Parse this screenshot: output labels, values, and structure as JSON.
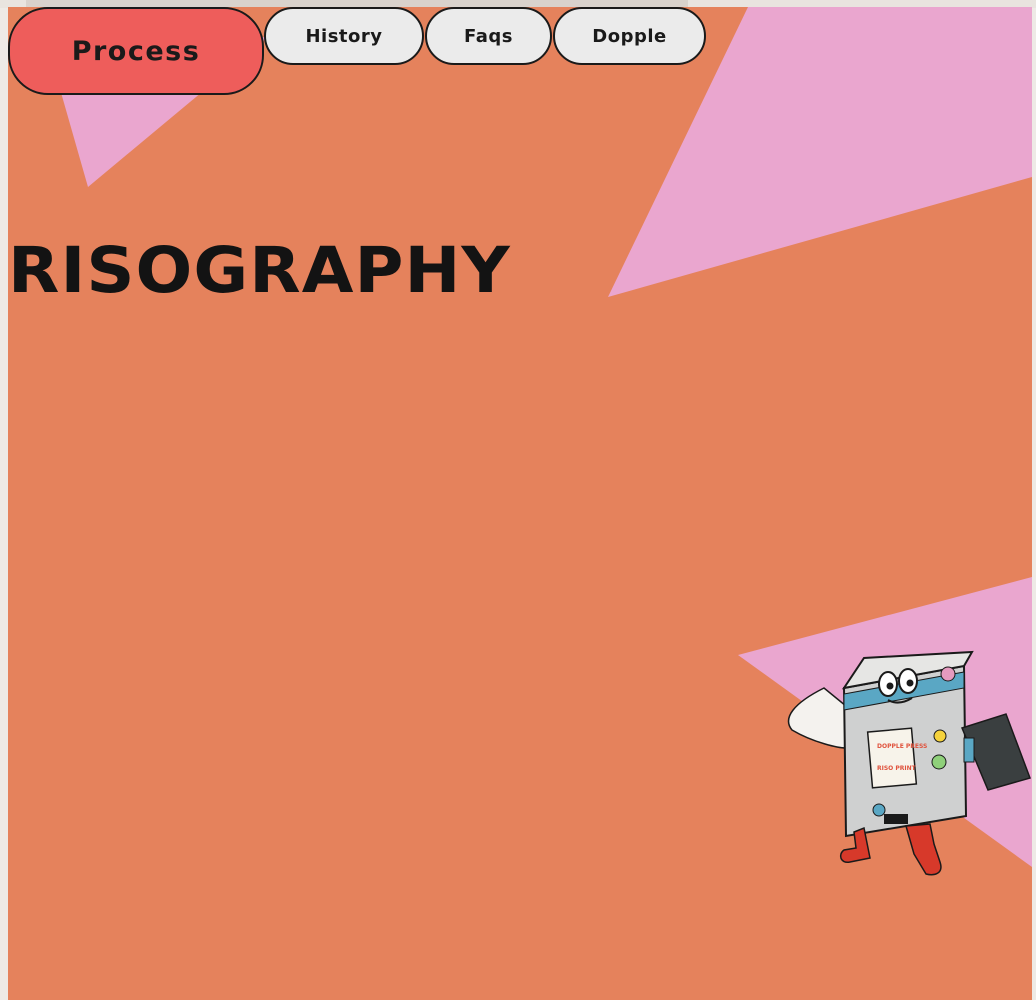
{
  "nav": {
    "items": [
      {
        "label": "Process",
        "active": true
      },
      {
        "label": "History",
        "active": false
      },
      {
        "label": "Faqs",
        "active": false
      },
      {
        "label": "Dopple",
        "active": false
      }
    ]
  },
  "hero": {
    "title": "RISOGRAPHY"
  },
  "mascot": {
    "sticker_top": "DOPPLE PRESS",
    "sticker_bottom": "RISO PRINT"
  },
  "colors": {
    "background_orange": "#e5825c",
    "background_pink": "#eaa6cf",
    "active_nav": "#ee5d5b",
    "nav_inactive": "#ebebeb",
    "title_text": "#131313"
  }
}
